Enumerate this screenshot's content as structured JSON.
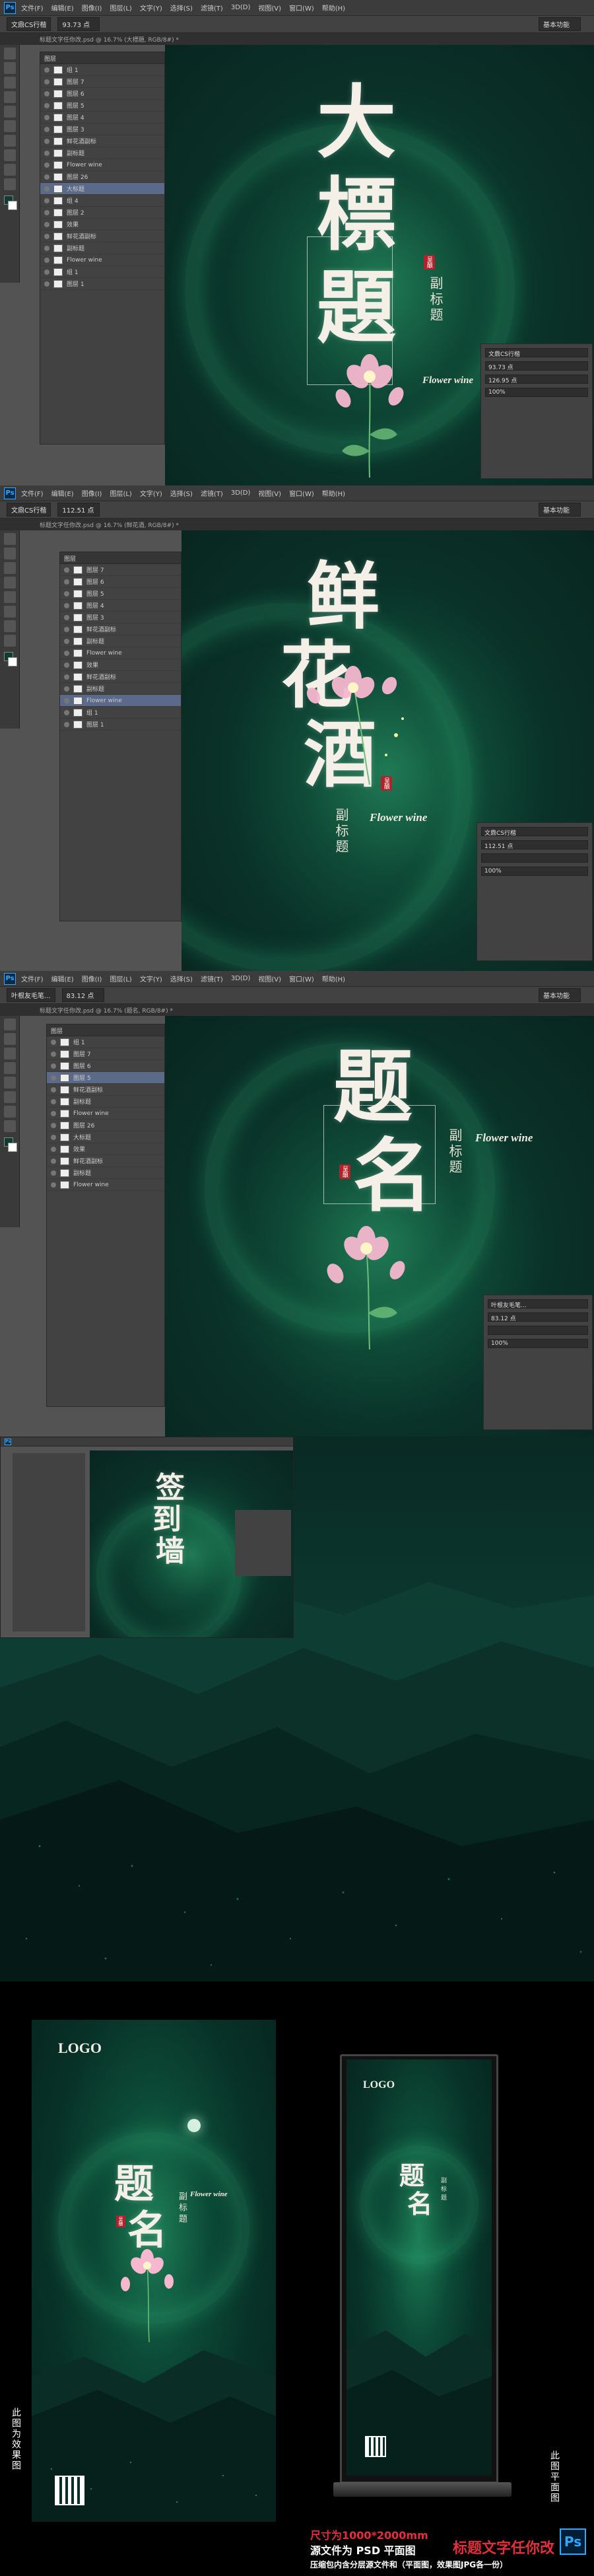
{
  "ps": {
    "logo": "Ps",
    "menu": [
      "文件(F)",
      "编辑(E)",
      "图像(I)",
      "图层(L)",
      "文字(Y)",
      "选择(S)",
      "滤镜(T)",
      "3D(D)",
      "视图(V)",
      "窗口(W)",
      "帮助(H)"
    ],
    "workspace_btn": "基本功能",
    "screens": [
      {
        "tool_field": "文鼎CS行楷",
        "size_field": "93.73 点",
        "tab": "标题文字任你改.psd @ 16.7% (大標題, RGB/8#) *",
        "title_chars": [
          "大",
          "標",
          "題"
        ],
        "seal": "呈酿",
        "subtitle": "副标题",
        "english": "Flower wine",
        "props_font": "文鼎CS行楷",
        "props_size": "93.73 点",
        "props_lead": "126.95 点",
        "props_track": "100%"
      },
      {
        "tool_field": "文鼎CS行楷",
        "size_field": "112.51 点",
        "tab": "标题文字任你改.psd @ 16.7% (鲜花酒, RGB/8#) *",
        "title_chars": [
          "鲜",
          "花",
          "酒"
        ],
        "seal": "呈酿",
        "subtitle": "副标题",
        "english": "Flower wine",
        "props_font": "文鼎CS行楷",
        "props_size": "112.51 点",
        "props_lead": "",
        "props_track": "100%"
      },
      {
        "tool_field": "叶根友毛笔...",
        "size_field": "83.12 点",
        "tab": "标题文字任你改.psd @ 16.7% (题名, RGB/8#) *",
        "title_chars": [
          "题",
          "名"
        ],
        "seal": "呈酿",
        "subtitle": "副标题",
        "english": "Flower wine",
        "props_font": "叶根友毛笔...",
        "props_size": "83.12 点",
        "props_lead": "",
        "props_track": "100%"
      }
    ],
    "small_screen": {
      "title_chars": [
        "签",
        "到",
        "墙"
      ]
    },
    "layers": [
      "组 1",
      "图层 7",
      "图层 6",
      "图层 5",
      "图层 4",
      "图层 3",
      "鲜花酒副标",
      "副标题",
      "Flower wine",
      "图层 26",
      "大标题",
      "组 4",
      "图层 2",
      "效果",
      "鲜花酒副标",
      "副标题",
      "Flower wine",
      "组 1",
      "图层 1"
    ],
    "layers_header": "图层"
  },
  "mockups": {
    "logo": "LOGO",
    "title_chars": [
      "题",
      "名"
    ],
    "subtitle": "副标题",
    "english": "Flower wine",
    "seal": "呈酿",
    "left_caption": "此图为效果图",
    "right_caption": "此图平面图",
    "size_note": "尺寸为1000*2000mm",
    "source_note": "源文件为 PSD 平面图",
    "edit_note": "标题文字任你改",
    "package_note": "压缩包内含分层源文件和（平面图，效果图JPG各一份）",
    "ps_badge": "Ps"
  },
  "colors": {
    "accent_red": "#e0303a",
    "note_white": "#ffffff",
    "ps_blue": "#31a8ff"
  }
}
